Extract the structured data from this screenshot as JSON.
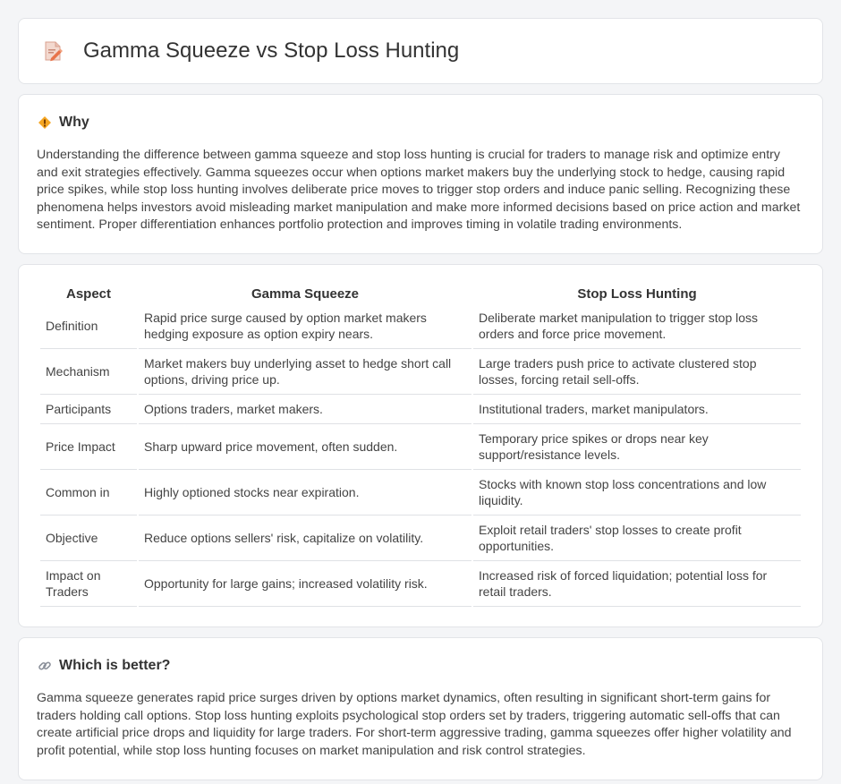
{
  "page": {
    "title": "Gamma Squeeze vs Stop Loss Hunting",
    "icon": "document-pen-icon"
  },
  "why": {
    "heading": "Why",
    "icon": "diamond-warning-icon",
    "text": "Understanding the difference between gamma squeeze and stop loss hunting is crucial for traders to manage risk and optimize entry and exit strategies effectively. Gamma squeezes occur when options market makers buy the underlying stock to hedge, causing rapid price spikes, while stop loss hunting involves deliberate price moves to trigger stop orders and induce panic selling. Recognizing these phenomena helps investors avoid misleading market manipulation and make more informed decisions based on price action and market sentiment. Proper differentiation enhances portfolio protection and improves timing in volatile trading environments."
  },
  "table": {
    "headers": [
      "Aspect",
      "Gamma Squeeze",
      "Stop Loss Hunting"
    ],
    "rows": [
      [
        "Definition",
        "Rapid price surge caused by option market makers hedging exposure as option expiry nears.",
        "Deliberate market manipulation to trigger stop loss orders and force price movement."
      ],
      [
        "Mechanism",
        "Market makers buy underlying asset to hedge short call options, driving price up.",
        "Large traders push price to activate clustered stop losses, forcing retail sell-offs."
      ],
      [
        "Participants",
        "Options traders, market makers.",
        "Institutional traders, market manipulators."
      ],
      [
        "Price Impact",
        "Sharp upward price movement, often sudden.",
        "Temporary price spikes or drops near key support/resistance levels."
      ],
      [
        "Common in",
        "Highly optioned stocks near expiration.",
        "Stocks with known stop loss concentrations and low liquidity."
      ],
      [
        "Objective",
        "Reduce options sellers' risk, capitalize on volatility.",
        "Exploit retail traders' stop losses to create profit opportunities."
      ],
      [
        "Impact on Traders",
        "Opportunity for large gains; increased volatility risk.",
        "Increased risk of forced liquidation; potential loss for retail traders."
      ]
    ]
  },
  "better": {
    "heading": "Which is better?",
    "icon": "link-icon",
    "text": "Gamma squeeze generates rapid price surges driven by options market dynamics, often resulting in significant short-term gains for traders holding call options. Stop loss hunting exploits psychological stop orders set by traders, triggering automatic sell-offs that can create artificial price drops and liquidity for large traders. For short-term aggressive trading, gamma squeezes offer higher volatility and profit potential, while stop loss hunting focuses on market manipulation and risk control strategies."
  }
}
